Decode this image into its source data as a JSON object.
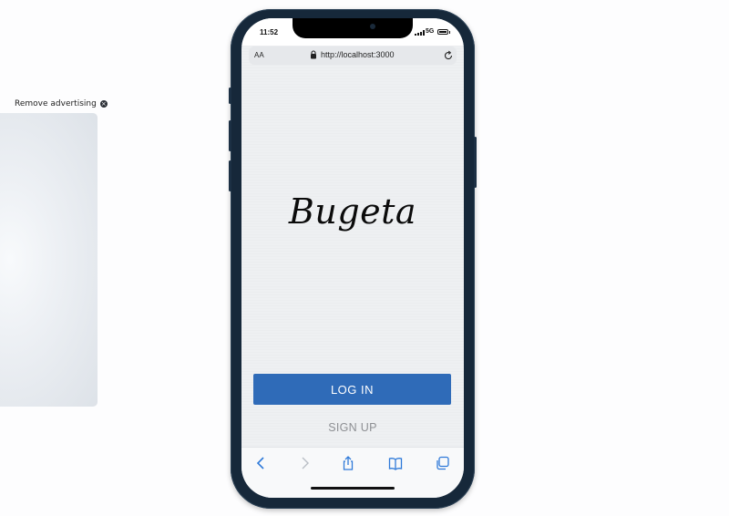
{
  "ad": {
    "remove_label": "Remove advertising"
  },
  "phone": {
    "status": {
      "time": "11:52",
      "network": "5G"
    },
    "browser": {
      "text_size_label": "AA",
      "url": "http://localhost:3000"
    },
    "app": {
      "logo_text": "Bugeta",
      "login_label": "LOG IN",
      "signup_label": "SIGN UP"
    },
    "toolbar": {
      "icons": [
        "chevron-left-icon",
        "chevron-right-icon",
        "share-icon",
        "bookmarks-icon",
        "tabs-icon"
      ]
    }
  },
  "colors": {
    "primary_button": "#2f6bb8",
    "secondary_text": "#8d8f93",
    "toolbar_icon": "#2f7ad9",
    "frame": "#16283a"
  }
}
